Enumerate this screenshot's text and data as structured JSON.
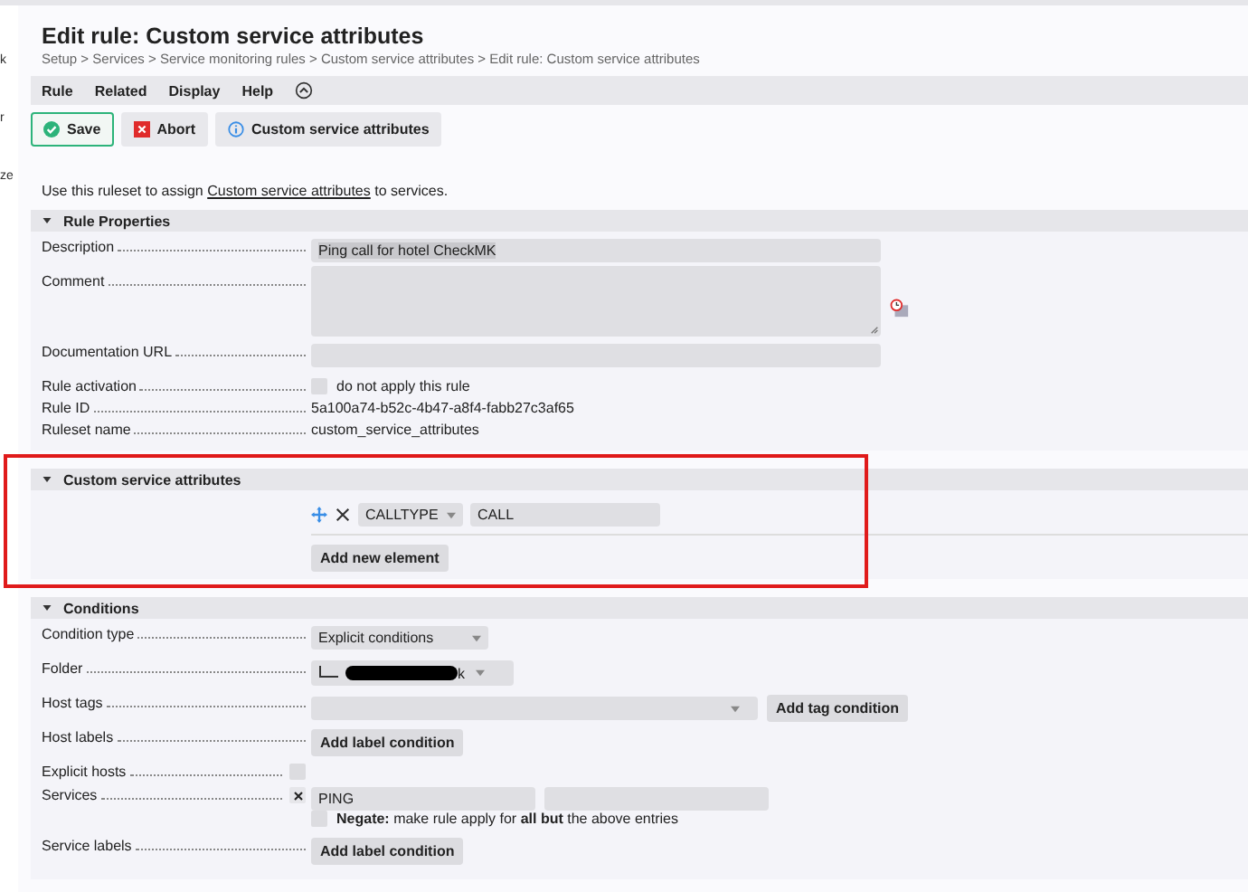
{
  "sidebar_fragments": [
    "k",
    "r",
    "ze"
  ],
  "title": "Edit rule: Custom service attributes",
  "breadcrumb": "Setup > Services > Service monitoring rules > Custom service attributes > Edit rule: Custom service attributes",
  "menu": [
    "Rule",
    "Related",
    "Display",
    "Help"
  ],
  "buttons": [
    {
      "label": "Save",
      "kind": "save"
    },
    {
      "label": "Abort",
      "kind": "abort"
    },
    {
      "label": "Custom service attributes",
      "kind": "info"
    }
  ],
  "intro": {
    "before": "Use this ruleset to assign ",
    "link": "Custom service attributes",
    "after": " to services."
  },
  "rule_properties": {
    "title": "Rule Properties",
    "expanded": true,
    "rows": [
      {
        "label": "Description",
        "kind": "text",
        "value": "Ping call for hotel CheckMK"
      },
      {
        "label": "Comment",
        "kind": "textarea"
      },
      {
        "label": "Documentation URL",
        "kind": "text"
      },
      {
        "label": "Rule activation",
        "kind": "checkbox",
        "checked": false,
        "text": "do not apply this rule"
      },
      {
        "label": "Rule ID",
        "kind": "plain",
        "value": "5a100a74-b52c-4b47-a8f4-fabb27c3af65"
      },
      {
        "label": "Ruleset name",
        "kind": "plain",
        "value": "custom_service_attributes"
      }
    ]
  },
  "custom_attributes": {
    "title": "Custom service attributes",
    "expanded": true,
    "highlighted": true,
    "entries": [
      {
        "key": "CALLTYPE",
        "value": "CALL"
      }
    ],
    "add_button": "Add new element"
  },
  "conditions": {
    "title": "Conditions",
    "expanded": true,
    "rows": [
      {
        "label": "Condition type",
        "kind": "select",
        "value": "Explicit conditions"
      },
      {
        "label": "Folder",
        "kind": "folder",
        "value": "k"
      },
      {
        "label": "Host tags",
        "kind": "tags",
        "button": "Add tag condition"
      },
      {
        "label": "Host labels",
        "kind": "button",
        "button": "Add label condition"
      },
      {
        "label": "Explicit hosts",
        "kind": "checkbox",
        "checked": false
      },
      {
        "label": "Services",
        "kind": "services",
        "checked": true,
        "values": [
          "PING"
        ]
      },
      {
        "label": "",
        "kind": "negate",
        "checked": false,
        "text": "**Negate:** make rule apply for **all but** the above entries"
      },
      {
        "label": "Service labels",
        "kind": "button",
        "button": "Add label condition"
      }
    ]
  }
}
